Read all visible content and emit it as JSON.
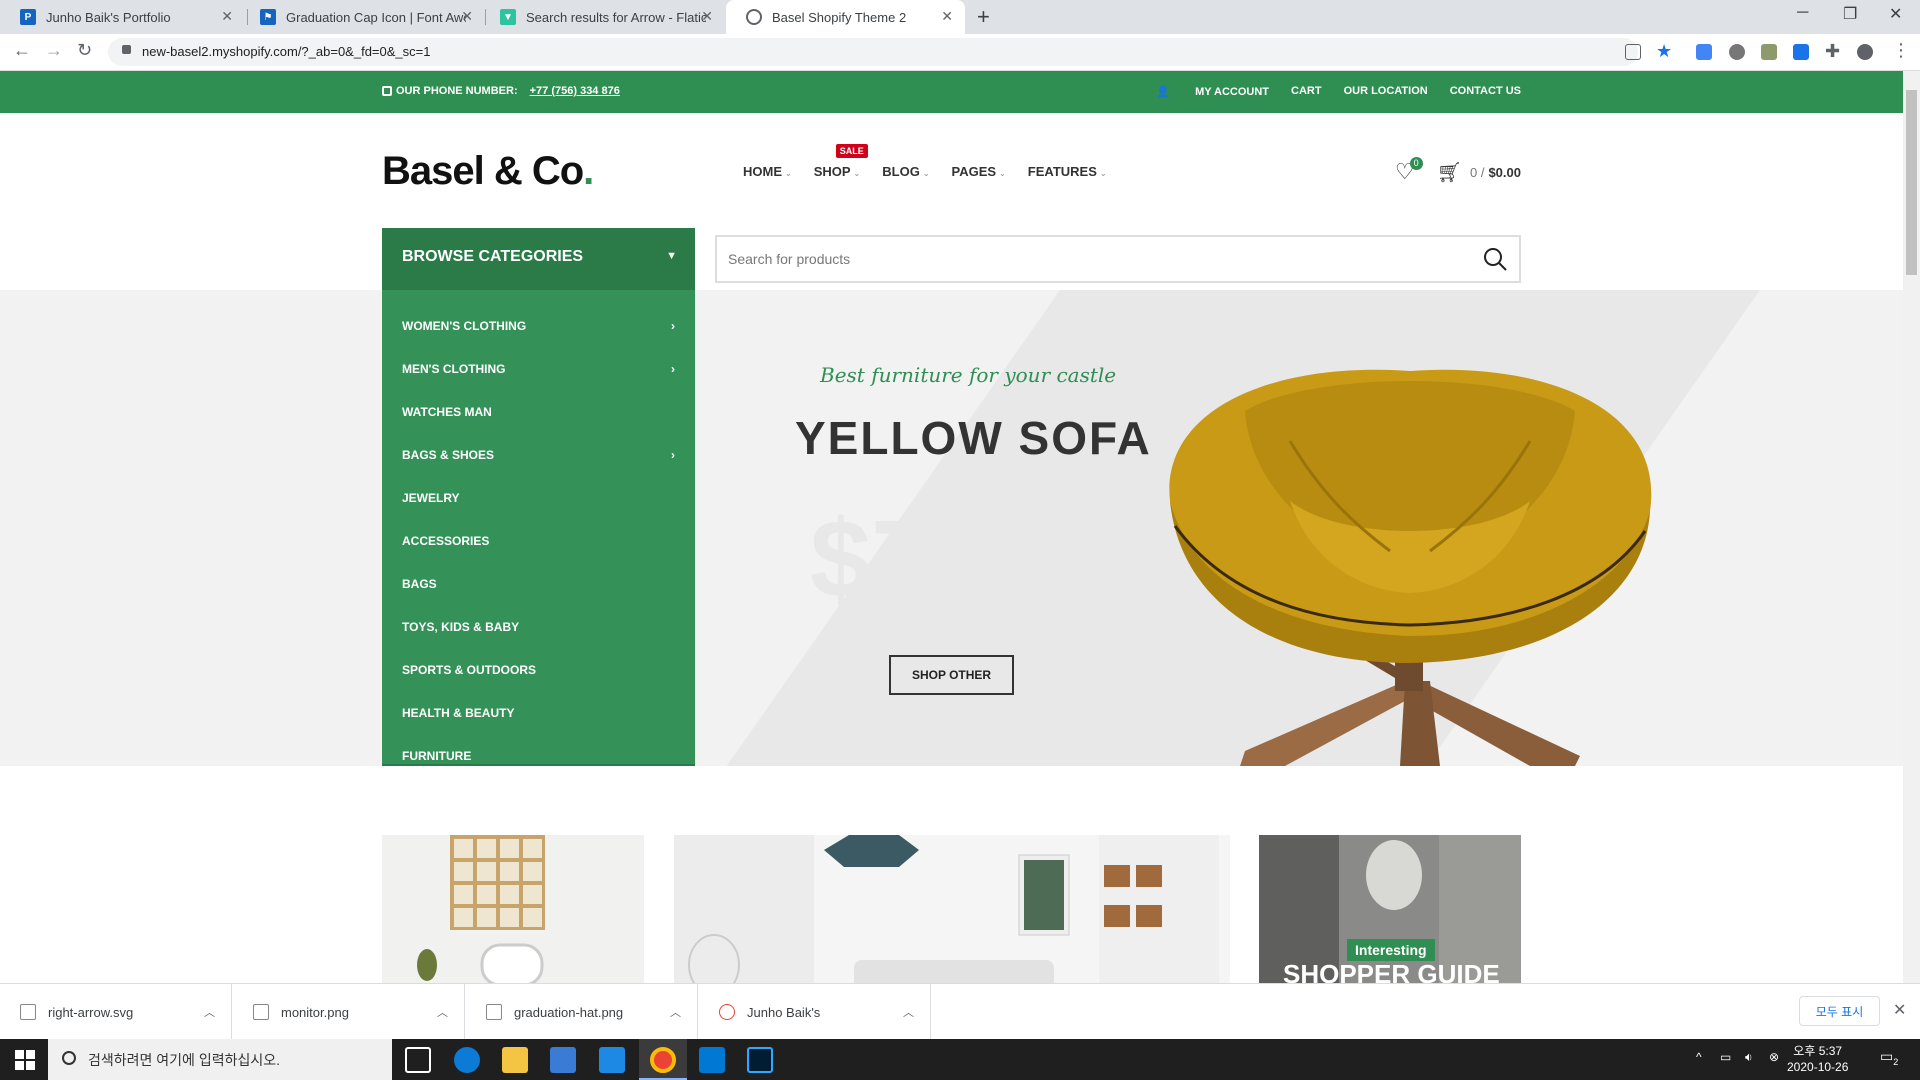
{
  "browser": {
    "tabs": [
      {
        "title": "Junho Baik's Portfolio",
        "active": false,
        "favicon_color": "#1565c0"
      },
      {
        "title": "Graduation Cap Icon | Font Awe",
        "active": false,
        "favicon_color": "#1565c0"
      },
      {
        "title": "Search results for Arrow - Flatic",
        "active": false,
        "favicon_color": "#2ec4a0"
      },
      {
        "title": "Basel Shopify Theme 2",
        "active": true,
        "favicon_color": "#5f6368"
      }
    ],
    "url": "new-basel2.myshopify.com/?_ab=0&_fd=0&_sc=1"
  },
  "page": {
    "topbar": {
      "phone_label": "OUR PHONE NUMBER:",
      "phone_number": "+77 (756) 334 876",
      "links": [
        "MY ACCOUNT",
        "CART",
        "OUR LOCATION",
        "CONTACT US"
      ]
    },
    "logo": {
      "text": "Basel & Co",
      "dot": "."
    },
    "nav": {
      "items": [
        "HOME",
        "SHOP",
        "BLOG",
        "PAGES",
        "FEATURES"
      ],
      "sale_badge": "SALE"
    },
    "wishlist_count": "0",
    "cart": {
      "count": "0 /",
      "total": "$0.00"
    },
    "categories": {
      "title": "BROWSE CATEGORIES",
      "items": [
        {
          "label": "WOMEN'S CLOTHING",
          "has_sub": true
        },
        {
          "label": "MEN'S CLOTHING",
          "has_sub": true
        },
        {
          "label": "WATCHES MAN",
          "has_sub": false
        },
        {
          "label": "BAGS & SHOES",
          "has_sub": true
        },
        {
          "label": "JEWELRY",
          "has_sub": false
        },
        {
          "label": "ACCESSORIES",
          "has_sub": false
        },
        {
          "label": "BAGS",
          "has_sub": false
        },
        {
          "label": "TOYS, KIDS & BABY",
          "has_sub": false
        },
        {
          "label": "SPORTS & OUTDOORS",
          "has_sub": false
        },
        {
          "label": "HEALTH & BEAUTY",
          "has_sub": false
        },
        {
          "label": "FURNITURE",
          "has_sub": false
        }
      ]
    },
    "search": {
      "placeholder": "Search for products"
    },
    "hero": {
      "tagline": "Best furniture for your castle",
      "headline": "YELLOW SOFA",
      "price": "$799",
      "button": "SHOP OTHER"
    },
    "promos": {
      "third_label": "Interesting",
      "third_title": "SHOPPER GUIDE"
    },
    "colors": {
      "brand_green": "#2f8e52",
      "dark_green": "#2a7b48",
      "sale_red": "#d0021b"
    }
  },
  "downloads": {
    "items": [
      "right-arrow.svg",
      "monitor.png",
      "graduation-hat.png",
      "Junho Baik's"
    ],
    "show_all": "모두 표시"
  },
  "taskbar": {
    "search_placeholder": "검색하려면 여기에 입력하십시오.",
    "time": "오후 5:37",
    "date": "2020-10-26",
    "notifications": "2"
  }
}
